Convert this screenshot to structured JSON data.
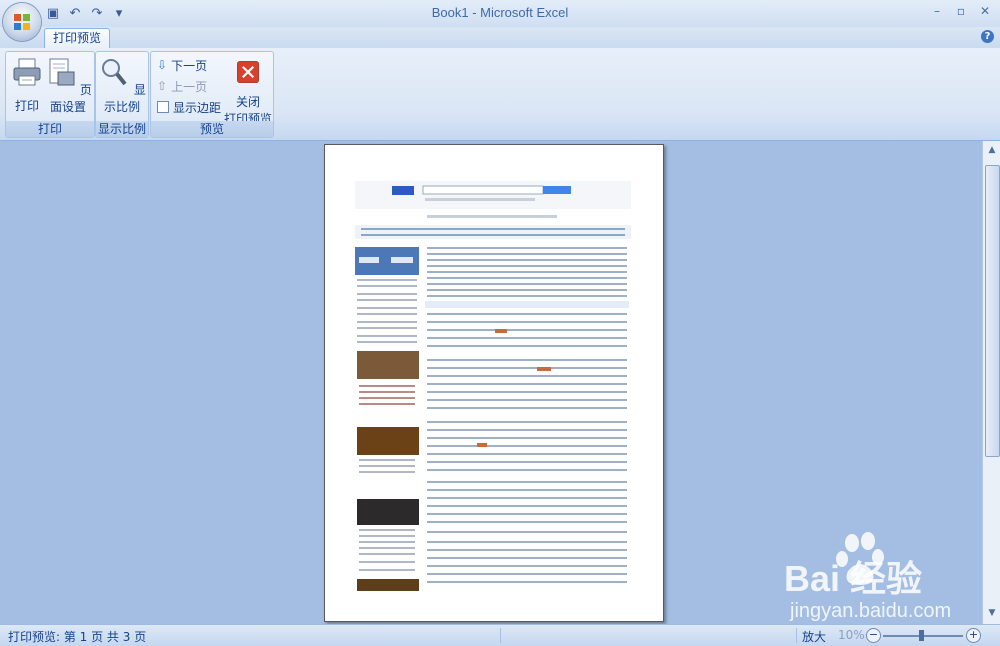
{
  "window": {
    "title": "Book1 - Microsoft Excel"
  },
  "quick_access": {
    "save": "save-icon",
    "undo": "undo-icon",
    "redo": "redo-icon",
    "customize": "customize-icon"
  },
  "tabs": [
    {
      "label": "打印预览"
    }
  ],
  "ribbon": {
    "print_group": {
      "label": "打印",
      "print_button": "打印",
      "page_setup_button": "页面设置"
    },
    "zoom_group": {
      "label": "显示比例",
      "zoom_button": "显示比例"
    },
    "preview_group": {
      "label": "预览",
      "next_page": "下一页",
      "prev_page": "上一页",
      "show_margins": "显示边距",
      "close_button": "关闭",
      "close_button_line2": "打印预览"
    }
  },
  "status": {
    "text": "打印预览: 第 1 页  共 3 页",
    "zoom_label": "放大",
    "zoom_value": "10%"
  },
  "watermark": {
    "logo": "Bai 经验",
    "url": "jingyan.baidu.com"
  },
  "colors": {
    "ribbon_text": "#15428b",
    "workspace": "#a3bde3",
    "close_red": "#d9402b"
  }
}
